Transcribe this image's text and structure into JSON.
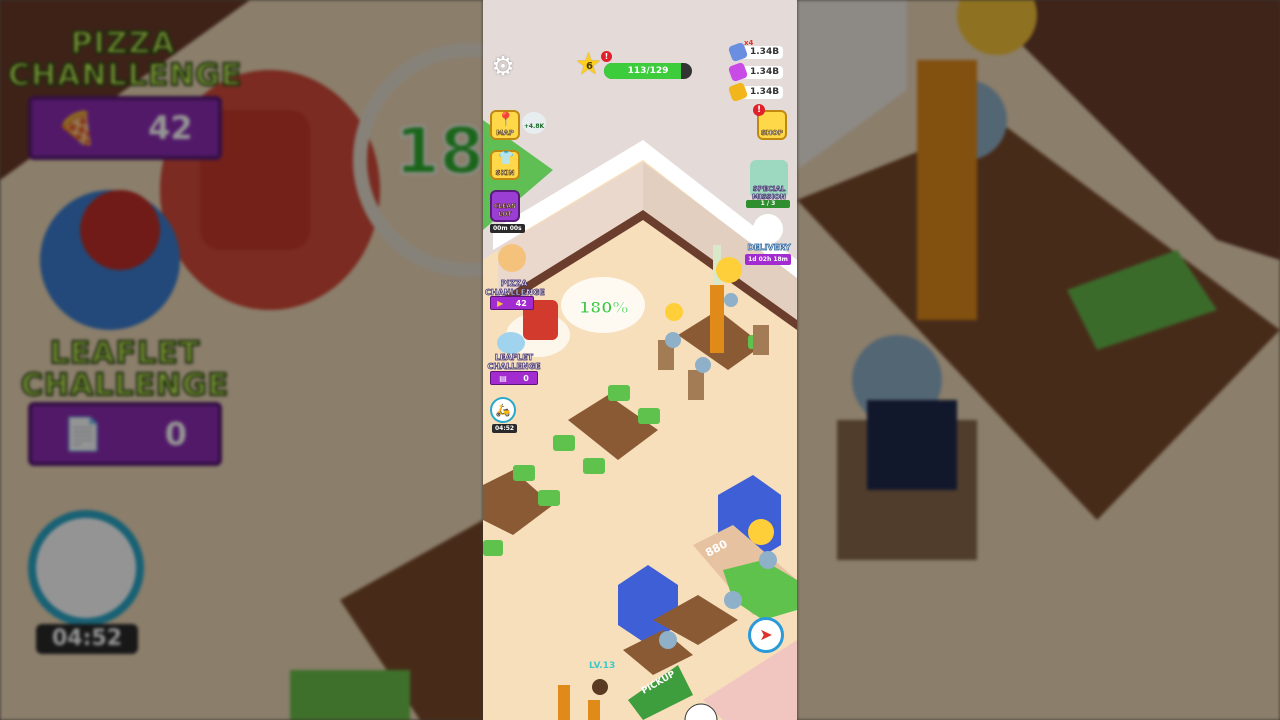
{
  "hud": {
    "level": "6",
    "xp_text": "113/129",
    "xp_fraction": 0.876,
    "currencies": [
      {
        "icon": "ticket-icon",
        "amount": "1.34B",
        "multiplier": "x4",
        "color": "#6a8ee0"
      },
      {
        "icon": "gem-icon",
        "amount": "1.34B",
        "color": "#c94be6"
      },
      {
        "icon": "coin-icon",
        "amount": "1.34B",
        "color": "#f2b51c"
      }
    ]
  },
  "left_menu": {
    "map_label": "MAP",
    "map_badge": "+4.8K",
    "skin_label": "SKIN",
    "clean_label": "CLEAN\nLOT",
    "clean_timer": "00m 00s",
    "pizza_label": "PIZZA\nCHANLLENGE",
    "pizza_count": "42",
    "leaflet_label": "LEAFLET\nCHALLENGE",
    "leaflet_count": "0",
    "delivery_timer": "04:52"
  },
  "right_menu": {
    "shop_label": "SHOP",
    "special_label": "SPECIAL\nMISSION",
    "special_progress": "1 / 3",
    "delivery_label": "DELIVERY",
    "delivery_timer": "1d 02h 18m"
  },
  "world": {
    "boost_text": "180%",
    "counter_text": "880",
    "stand_level": "LV.13",
    "pickup_label": "PICKUP"
  },
  "background_left": {
    "pizza_title": "PIZZA\nCHANLLENGE",
    "pizza_count": "42",
    "leaflet_title": "LEAFLET\nCHALLENGE",
    "leaflet_count": "0",
    "timer": "04:52",
    "boost_partial": "18"
  }
}
